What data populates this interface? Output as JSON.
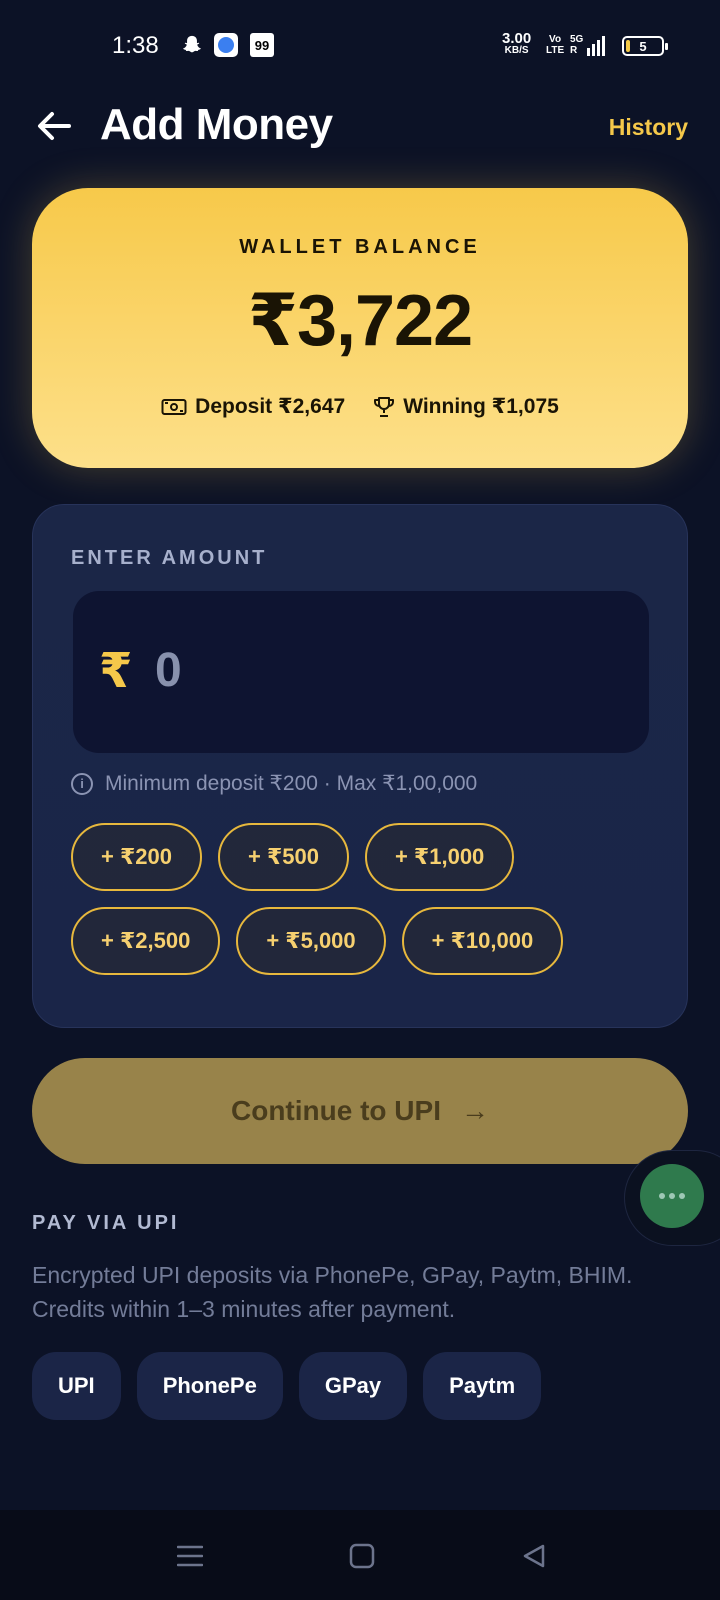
{
  "status_bar": {
    "time": "1:38",
    "notif_99": "99",
    "net_speed_value": "3.00",
    "net_speed_unit": "KB/S",
    "volte_top": "Vo",
    "volte_bottom": "LTE",
    "network_type": "5G",
    "signal_r": "R",
    "battery_level": "5"
  },
  "header": {
    "title": "Add Money",
    "history_label": "History"
  },
  "wallet": {
    "label": "WALLET BALANCE",
    "amount": "₹3,722",
    "deposit_label": "Deposit ₹2,647",
    "winning_label": "Winning ₹1,075"
  },
  "amount_entry": {
    "label": "ENTER AMOUNT",
    "currency_symbol": "₹",
    "value": "0",
    "hint": "Minimum deposit ₹200 · Max ₹1,00,000",
    "quick_amounts_row1": [
      "+ ₹200",
      "+ ₹500",
      "+ ₹1,000"
    ],
    "quick_amounts_row2": [
      "+ ₹2,500",
      "+ ₹5,000",
      "+ ₹10,000"
    ]
  },
  "continue_button": {
    "label": "Continue to UPI",
    "arrow": "→"
  },
  "upi": {
    "title": "PAY VIA UPI",
    "description": "Encrypted UPI deposits via PhonePe, GPay, Paytm, BHIM. Credits within 1–3 minutes after payment.",
    "methods": [
      "UPI",
      "PhonePe",
      "GPay",
      "Paytm"
    ]
  },
  "colors": {
    "background": "#0c1226",
    "accent": "#f5c84a",
    "card": "#1b2647",
    "button_disabled": "#98834a"
  }
}
